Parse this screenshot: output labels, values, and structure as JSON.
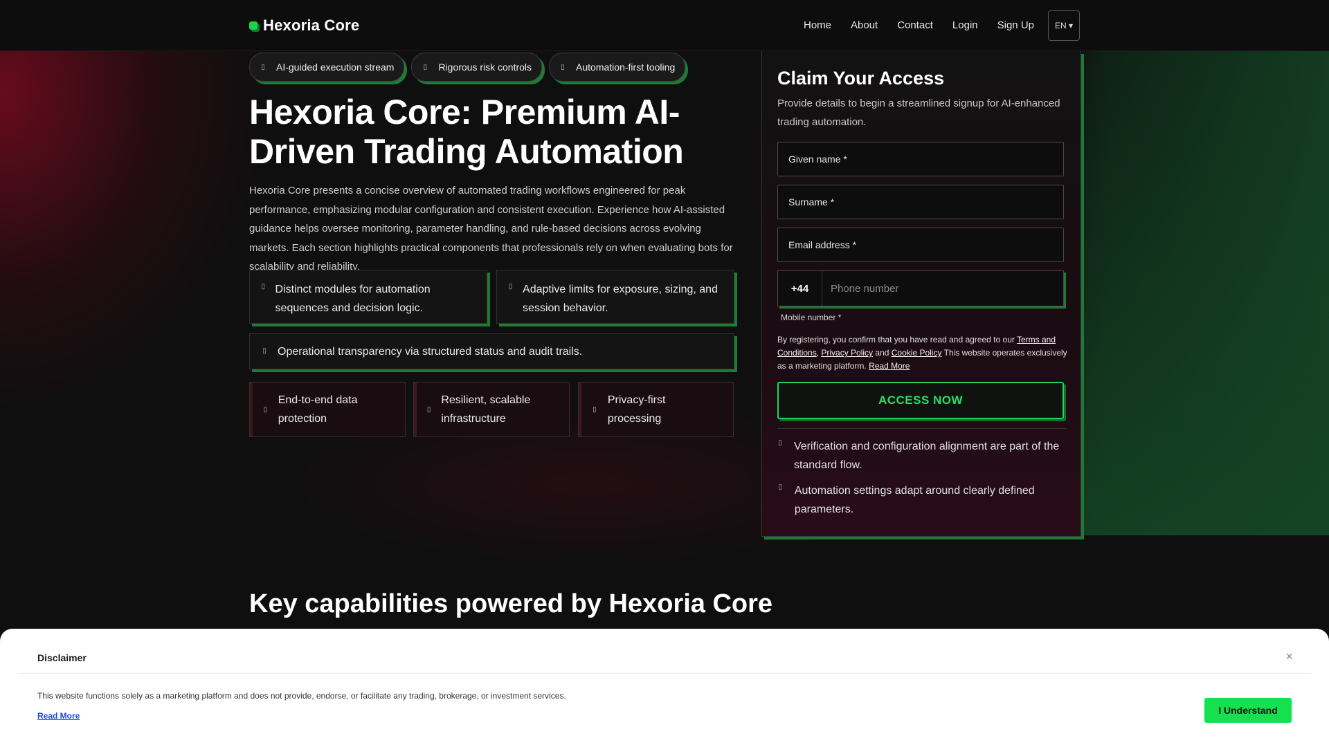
{
  "brand": {
    "name": "Hexoria Core",
    "accent": "#19d24b"
  },
  "nav": {
    "items": [
      "Home",
      "About",
      "Contact",
      "Login",
      "Sign Up"
    ],
    "lang": "EN ▾"
  },
  "pills": [
    "AI-guided execution stream",
    "Rigorous risk controls",
    "Automation-first tooling"
  ],
  "hero": {
    "title": "Hexoria Core: Premium AI-Driven Trading Automation",
    "intro": "Hexoria Core presents a concise overview of automated trading workflows engineered for peak performance, emphasizing modular configuration and consistent execution. Experience how AI-assisted guidance helps oversee monitoring, parameter handling, and rule-based decisions across evolving markets. Each section highlights practical components that professionals rely on when evaluating bots for scalability and reliability."
  },
  "features": [
    "Distinct modules for automation sequences and decision logic.",
    "Adaptive limits for exposure, sizing, and session behavior.",
    "Operational transparency via structured status and audit trails."
  ],
  "badges": [
    "End-to-end data protection",
    "Resilient, scalable infrastructure",
    "Privacy-first processing"
  ],
  "form": {
    "title": "Claim Your Access",
    "subtitle": "Provide details to begin a streamlined signup for AI-enhanced trading automation.",
    "given_name": "Given name *",
    "surname": "Surname *",
    "email": "Email address *",
    "phone_code": "+44",
    "phone_placeholder": "Phone number",
    "mobile_label": "Mobile number *",
    "terms": {
      "prefix": "By registering, you confirm that you have read and agreed to our ",
      "terms_link": "Terms and Conditions",
      "comma": ", ",
      "privacy_link": "Privacy Policy",
      "and": " and ",
      "cookie_link": "Cookie Policy",
      "suffix": " This website operates exclusively as a marketing platform. ",
      "read_more": "Read More"
    },
    "submit": "ACCESS NOW",
    "notes": [
      "Verification and configuration alignment are part of the standard flow.",
      "Automation settings adapt around clearly defined parameters."
    ]
  },
  "section": {
    "title": "Key capabilities powered by Hexoria Core"
  },
  "disclaimer": {
    "title": "Disclaimer",
    "close": "×",
    "text": "This website functions solely as a marketing platform and does not provide, endorse, or facilitate any trading, brokerage, or investment services.",
    "read_more": "Read More",
    "button": "I Understand"
  }
}
